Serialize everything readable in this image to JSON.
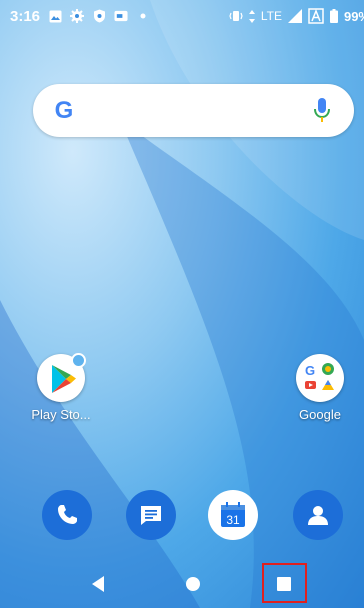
{
  "status_bar": {
    "time": "3:16",
    "network": "LTE",
    "battery": "99%"
  },
  "search": {
    "logo_letter": "G"
  },
  "apps": [
    {
      "label": "Play Sto..."
    },
    {
      "label": "Google"
    }
  ],
  "dock": {
    "calendar_date": "31"
  },
  "colors": {
    "accent": "#1a73e8",
    "focus_outline": "#e0201f"
  }
}
